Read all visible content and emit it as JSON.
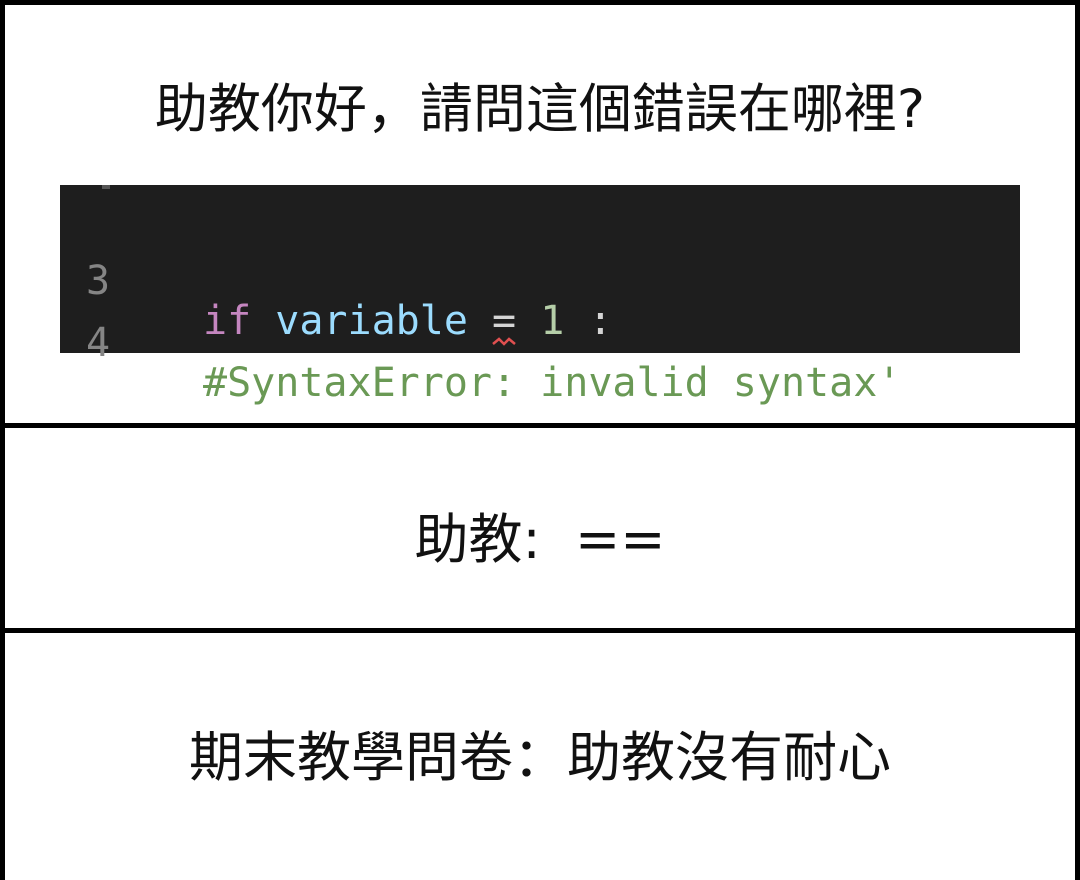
{
  "panels": {
    "question": {
      "text": "助教你好，請問這個錯誤在哪裡?"
    },
    "code_snippet": {
      "line1": {
        "number": "3",
        "keyword": "if",
        "variable": "variable",
        "operator": "=",
        "value": "1",
        "colon": ":"
      },
      "line2": {
        "number": "4",
        "comment": "#SyntaxError: invalid syntax'"
      },
      "colors": {
        "background": "#1e1e1e",
        "keyword": "#c586c0",
        "variable": "#9cdcfe",
        "number": "#b5cea8",
        "comment": "#6a9955",
        "error_squiggle": "#e05050"
      }
    },
    "answer": {
      "text": "助教:  =="
    },
    "review": {
      "text": "期末教學問卷：助教沒有耐心"
    }
  }
}
